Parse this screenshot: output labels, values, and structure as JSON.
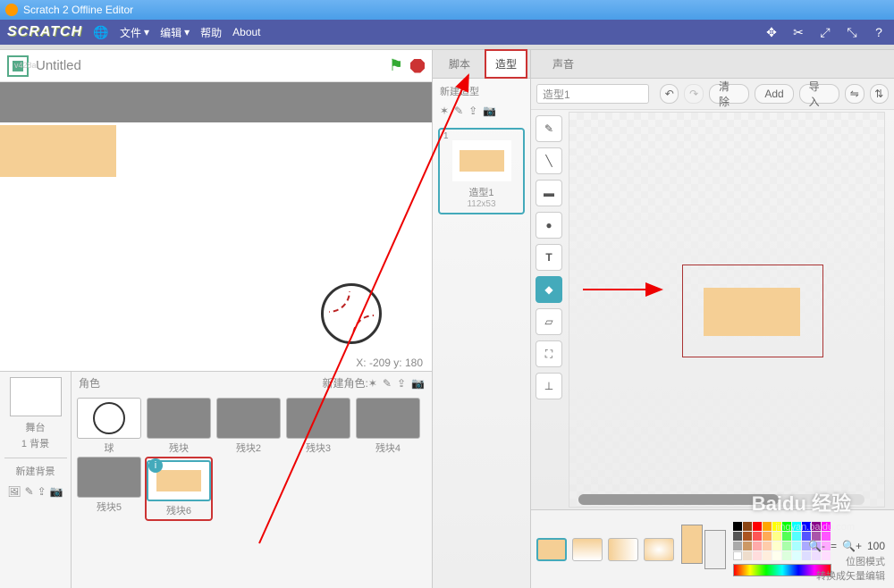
{
  "window_title": "Scratch 2 Offline Editor",
  "logo": "SCRATCH",
  "menu": {
    "file": "文件",
    "edit": "编辑",
    "help": "帮助",
    "about": "About"
  },
  "stage": {
    "title": "Untitled",
    "version": "v428a",
    "coords": "X: -209 y: 180"
  },
  "sprite_panel": {
    "heading": "角色",
    "new_sprite": "新建角色:",
    "stage_label": "舞台",
    "backdrops": "1 背景",
    "new_backdrop": "新建背景"
  },
  "sprites": [
    {
      "name": "球"
    },
    {
      "name": "残块"
    },
    {
      "name": "残块2"
    },
    {
      "name": "残块3"
    },
    {
      "name": "残块4"
    },
    {
      "name": "残块5"
    },
    {
      "name": "残块6"
    }
  ],
  "tabs": {
    "scripts": "脚本",
    "costumes": "造型",
    "sounds": "声音"
  },
  "costume_panel": {
    "new_costume": "新建造型",
    "name": "造型1",
    "size": "112x53",
    "index": "1"
  },
  "editor": {
    "name_input": "造型1",
    "clear": "清除",
    "add": "Add",
    "import": "导入",
    "zoom": "100",
    "mode_bitmap": "位图模式",
    "convert_vector": "转换成矢量编辑"
  },
  "watermark": {
    "brand": "Baidu 经验",
    "url": "jingyan.baidu.com"
  }
}
